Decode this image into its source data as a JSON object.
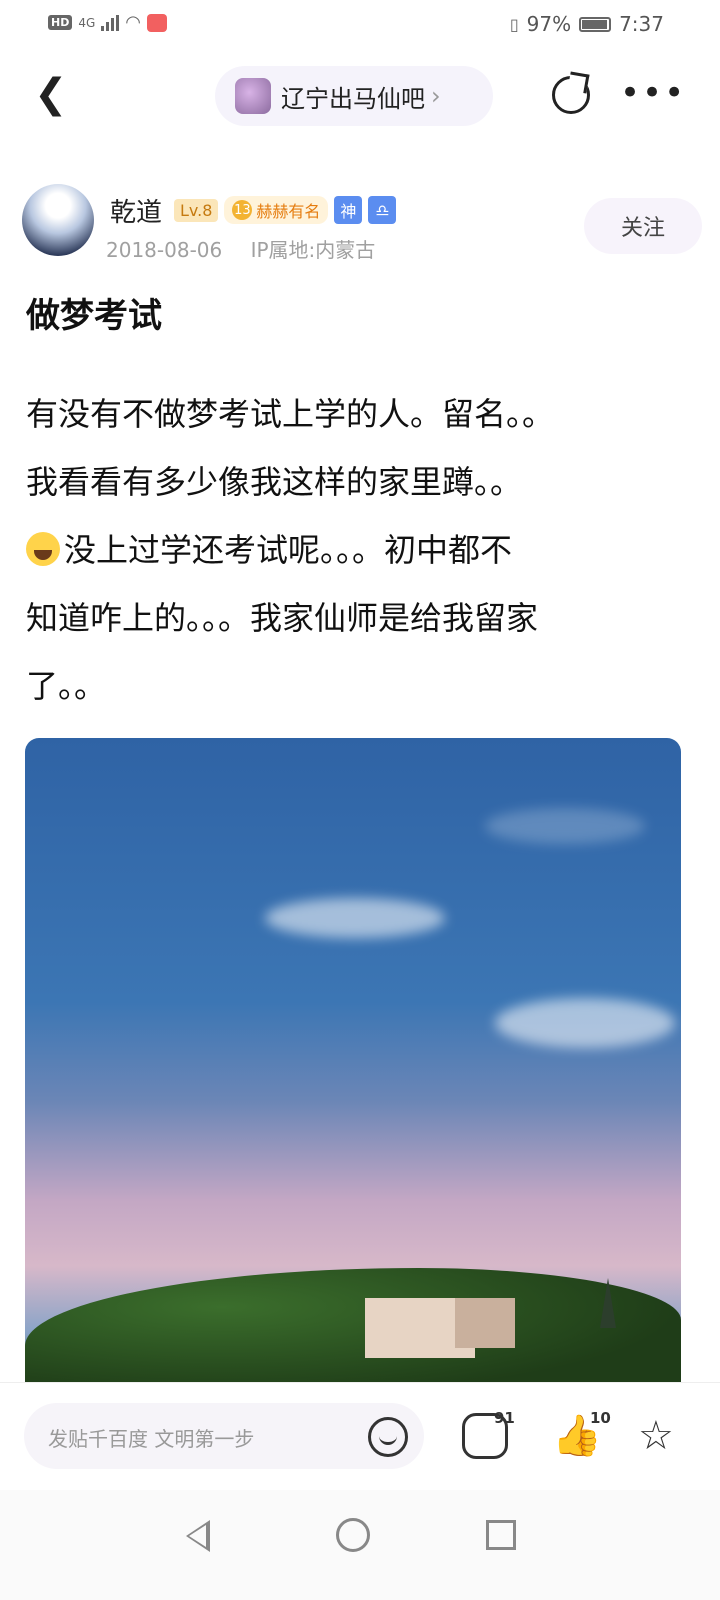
{
  "status_bar": {
    "network": "HD",
    "signal": "4G",
    "battery": "97%",
    "time": "7:37"
  },
  "nav": {
    "forum_name": "辽宁出马仙吧"
  },
  "author": {
    "name": "乾道",
    "level": "Lv.8",
    "honor_level": "13",
    "honor_title": "赫赫有名",
    "badge1": "神",
    "badge2": "♎",
    "date": "2018-08-06",
    "ip": "IP属地:内蒙古",
    "follow_label": "关注"
  },
  "post": {
    "title": "做梦考试",
    "line1": "有没有不做梦考试上学的人。留名。。",
    "line2": "我看看有多少像我这样的家里蹲。。",
    "line3": "没上过学还考试呢。。。初中都不",
    "line4": "知道咋上的。。。我家仙师是给我留家",
    "line5": "了。。"
  },
  "bottom": {
    "placeholder": "发贴千百度 文明第一步",
    "comment_count": "91",
    "like_count": "10"
  },
  "colors": {
    "accent": "#f6f4f9",
    "level_badge": "#fbe6b9",
    "honor_badge": "#f3b332",
    "blue_badge": "#5b8df0"
  },
  "icons": [
    "back-icon",
    "share-icon",
    "more-icon",
    "emoji-icon",
    "comment-icon",
    "like-icon",
    "star-icon"
  ]
}
